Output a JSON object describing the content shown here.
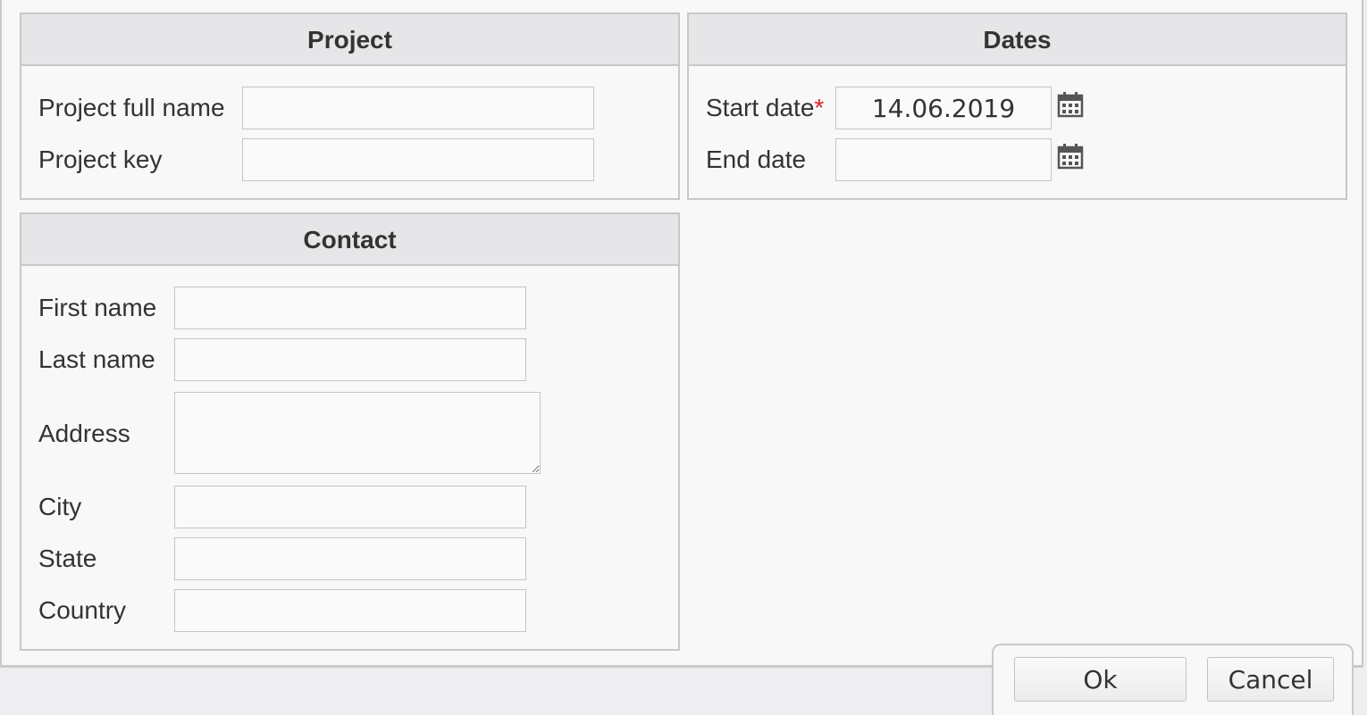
{
  "project": {
    "title": "Project",
    "full_name_label": "Project full name",
    "full_name_value": "",
    "key_label": "Project key",
    "key_value": ""
  },
  "dates": {
    "title": "Dates",
    "start_label": "Start date",
    "start_required_mark": "*",
    "start_value": "14.06.2019",
    "end_label": "End date",
    "end_value": "",
    "icon": "calendar-icon"
  },
  "contact": {
    "title": "Contact",
    "first_name_label": "First name",
    "first_name_value": "",
    "last_name_label": "Last name",
    "last_name_value": "",
    "address_label": "Address",
    "address_value": "",
    "city_label": "City",
    "city_value": "",
    "state_label": "State",
    "state_value": "",
    "country_label": "Country",
    "country_value": ""
  },
  "buttons": {
    "ok_label": "Ok",
    "cancel_label": "Cancel"
  }
}
